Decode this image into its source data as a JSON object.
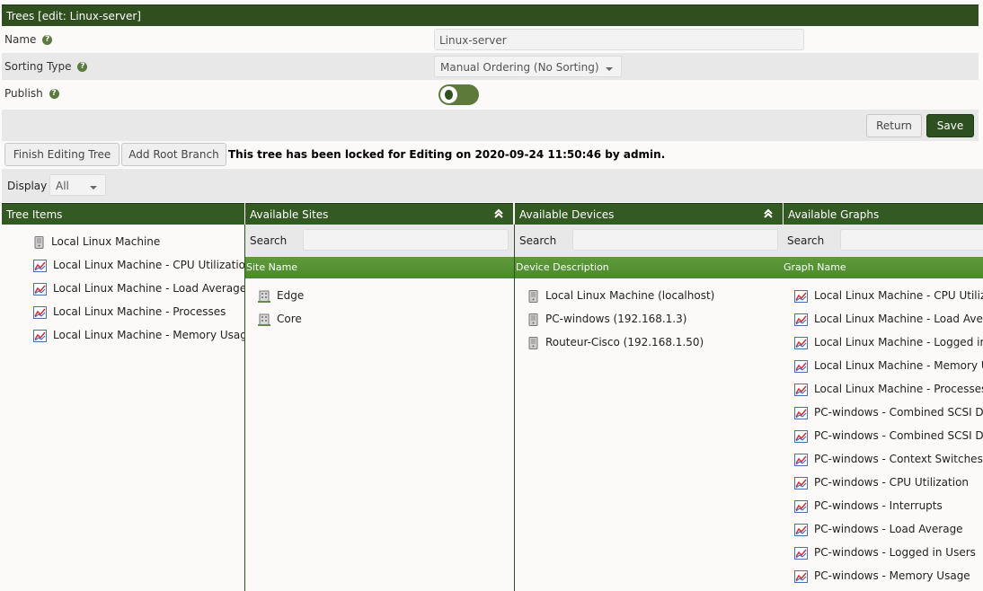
{
  "header": {
    "title": "Trees [edit: Linux-server]"
  },
  "form": {
    "name_label": "Name",
    "name_value": "Linux-server",
    "sorting_label": "Sorting Type",
    "sorting_value": "Manual Ordering (No Sorting)",
    "publish_label": "Publish",
    "publish_on": true,
    "help_glyph": "?"
  },
  "actions": {
    "return_label": "Return",
    "save_label": "Save"
  },
  "toolbar": {
    "finish_label": "Finish Editing Tree",
    "add_root_label": "Add Root Branch",
    "lock_message": "This tree has been locked for Editing on 2020-09-24 11:50:46 by admin."
  },
  "display": {
    "label": "Display",
    "value": "All"
  },
  "columns": {
    "tree_items": {
      "title": "Tree Items",
      "items": [
        {
          "icon": "server-icon",
          "label": "Local Linux Machine"
        },
        {
          "icon": "graph-icon",
          "label": "Local Linux Machine - CPU Utilization"
        },
        {
          "icon": "graph-icon",
          "label": "Local Linux Machine - Load Average"
        },
        {
          "icon": "graph-icon",
          "label": "Local Linux Machine - Processes"
        },
        {
          "icon": "graph-icon",
          "label": "Local Linux Machine - Memory Usage"
        }
      ]
    },
    "sites": {
      "title": "Available Sites",
      "search_label": "Search",
      "column_name": "Site Name",
      "items": [
        {
          "icon": "building-icon",
          "label": "Edge"
        },
        {
          "icon": "building-icon",
          "label": "Core"
        }
      ]
    },
    "devices": {
      "title": "Available Devices",
      "search_label": "Search",
      "column_name": "Device Description",
      "items": [
        {
          "icon": "server-icon",
          "label": "Local Linux Machine (localhost)"
        },
        {
          "icon": "server-icon",
          "label": "PC-windows (192.168.1.3)"
        },
        {
          "icon": "server-icon",
          "label": "Routeur-Cisco (192.168.1.50)"
        }
      ]
    },
    "graphs": {
      "title": "Available Graphs",
      "search_label": "Search",
      "column_name": "Graph Name",
      "items": [
        {
          "icon": "graph-icon",
          "label": "Local Linux Machine - CPU Utilizati"
        },
        {
          "icon": "graph-icon",
          "label": "Local Linux Machine - Load Averag"
        },
        {
          "icon": "graph-icon",
          "label": "Local Linux Machine - Logged in U"
        },
        {
          "icon": "graph-icon",
          "label": "Local Linux Machine - Memory Usa"
        },
        {
          "icon": "graph-icon",
          "label": "Local Linux Machine - Processes"
        },
        {
          "icon": "graph-icon",
          "label": "PC-windows - Combined SCSI Dis"
        },
        {
          "icon": "graph-icon",
          "label": "PC-windows - Combined SCSI Dis"
        },
        {
          "icon": "graph-icon",
          "label": "PC-windows - Context Switches"
        },
        {
          "icon": "graph-icon",
          "label": "PC-windows - CPU Utilization"
        },
        {
          "icon": "graph-icon",
          "label": "PC-windows - Interrupts"
        },
        {
          "icon": "graph-icon",
          "label": "PC-windows - Load Average"
        },
        {
          "icon": "graph-icon",
          "label": "PC-windows - Logged in Users"
        },
        {
          "icon": "graph-icon",
          "label": "PC-windows - Memory Usage"
        }
      ]
    }
  },
  "colors": {
    "header_green": "#2f4f1f",
    "subheader_green": "#55922f",
    "primary_button": "#2e5020"
  }
}
